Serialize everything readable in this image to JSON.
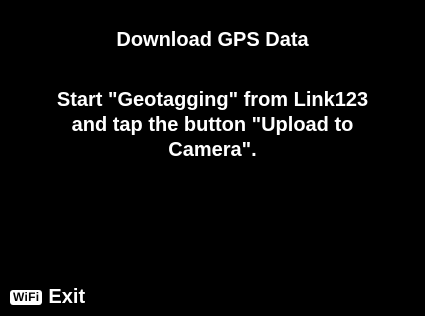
{
  "screen": {
    "title": "Download GPS Data",
    "message": "Start \"Geotagging\" from Link123 and tap the button \"Upload to Camera\".",
    "footer": {
      "wifi_button_label": "WiFi",
      "wifi_icon": "wifi-button-icon",
      "exit_label": "Exit"
    }
  },
  "colors": {
    "background": "#000000",
    "text": "#ffffff"
  }
}
